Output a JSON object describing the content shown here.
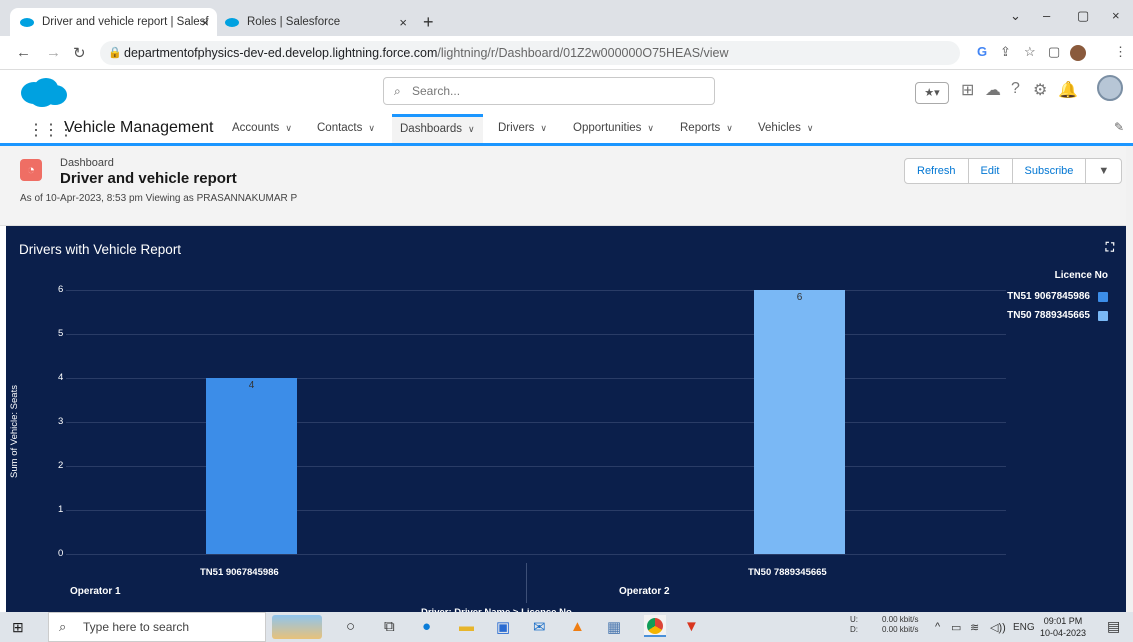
{
  "browser": {
    "tabs": [
      {
        "label": "Driver and vehicle report | Salesf",
        "close": "×"
      },
      {
        "label": "Roles | Salesforce",
        "close": "×"
      }
    ],
    "new_tab": "+",
    "window_controls": [
      "⌄",
      "–",
      "▢",
      "×"
    ],
    "url_host": "departmentofphysics-dev-ed.develop.lightning.force.com",
    "url_path": "/lightning/r/Dashboard/01Z2w000000O75HEAS/view"
  },
  "header": {
    "search_placeholder": "Search..."
  },
  "appnav": {
    "app_name": "Vehicle Management",
    "items": [
      {
        "label": "Accounts"
      },
      {
        "label": "Contacts"
      },
      {
        "label": "Dashboards"
      },
      {
        "label": "Drivers"
      },
      {
        "label": "Opportunities"
      },
      {
        "label": "Reports"
      },
      {
        "label": "Vehicles"
      }
    ]
  },
  "dashboard": {
    "subtitle": "Dashboard",
    "title": "Driver and vehicle report",
    "as_of": "As of 10-Apr-2023, 8:53 pm Viewing as PRASANNAKUMAR P",
    "buttons": {
      "refresh": "Refresh",
      "edit": "Edit",
      "subscribe": "Subscribe"
    }
  },
  "chart_data": {
    "type": "bar",
    "title": "Drivers with Vehicle Report",
    "ylabel": "Sum of Vehicle: Seats",
    "xlabel": "Driver: Driver Name > Licence No",
    "legend_title": "Licence No",
    "legend_placement": "top-right",
    "ylim": [
      0,
      6
    ],
    "yticks": [
      "0",
      "1",
      "2",
      "3",
      "4",
      "5",
      "6"
    ],
    "groups": [
      "Operator 1",
      "Operator 2"
    ],
    "categories": [
      "TN51 9067845986",
      "TN50 7889345665"
    ],
    "series": [
      {
        "name": "TN51 9067845986",
        "color": "#3c8de8",
        "values": [
          4,
          null
        ]
      },
      {
        "name": "TN50 7889345665",
        "color": "#7ab8f5",
        "values": [
          null,
          6
        ]
      }
    ],
    "bar_labels": [
      "4",
      "6"
    ],
    "grid": true
  },
  "taskbar": {
    "search_placeholder": "Type here to search",
    "net_up": "0.00 kbit/s",
    "net_down": "0.00 kbit/s",
    "up_label": "U:",
    "down_label": "D:",
    "lang": "ENG",
    "time": "09:01 PM",
    "date": "10-04-2023"
  }
}
